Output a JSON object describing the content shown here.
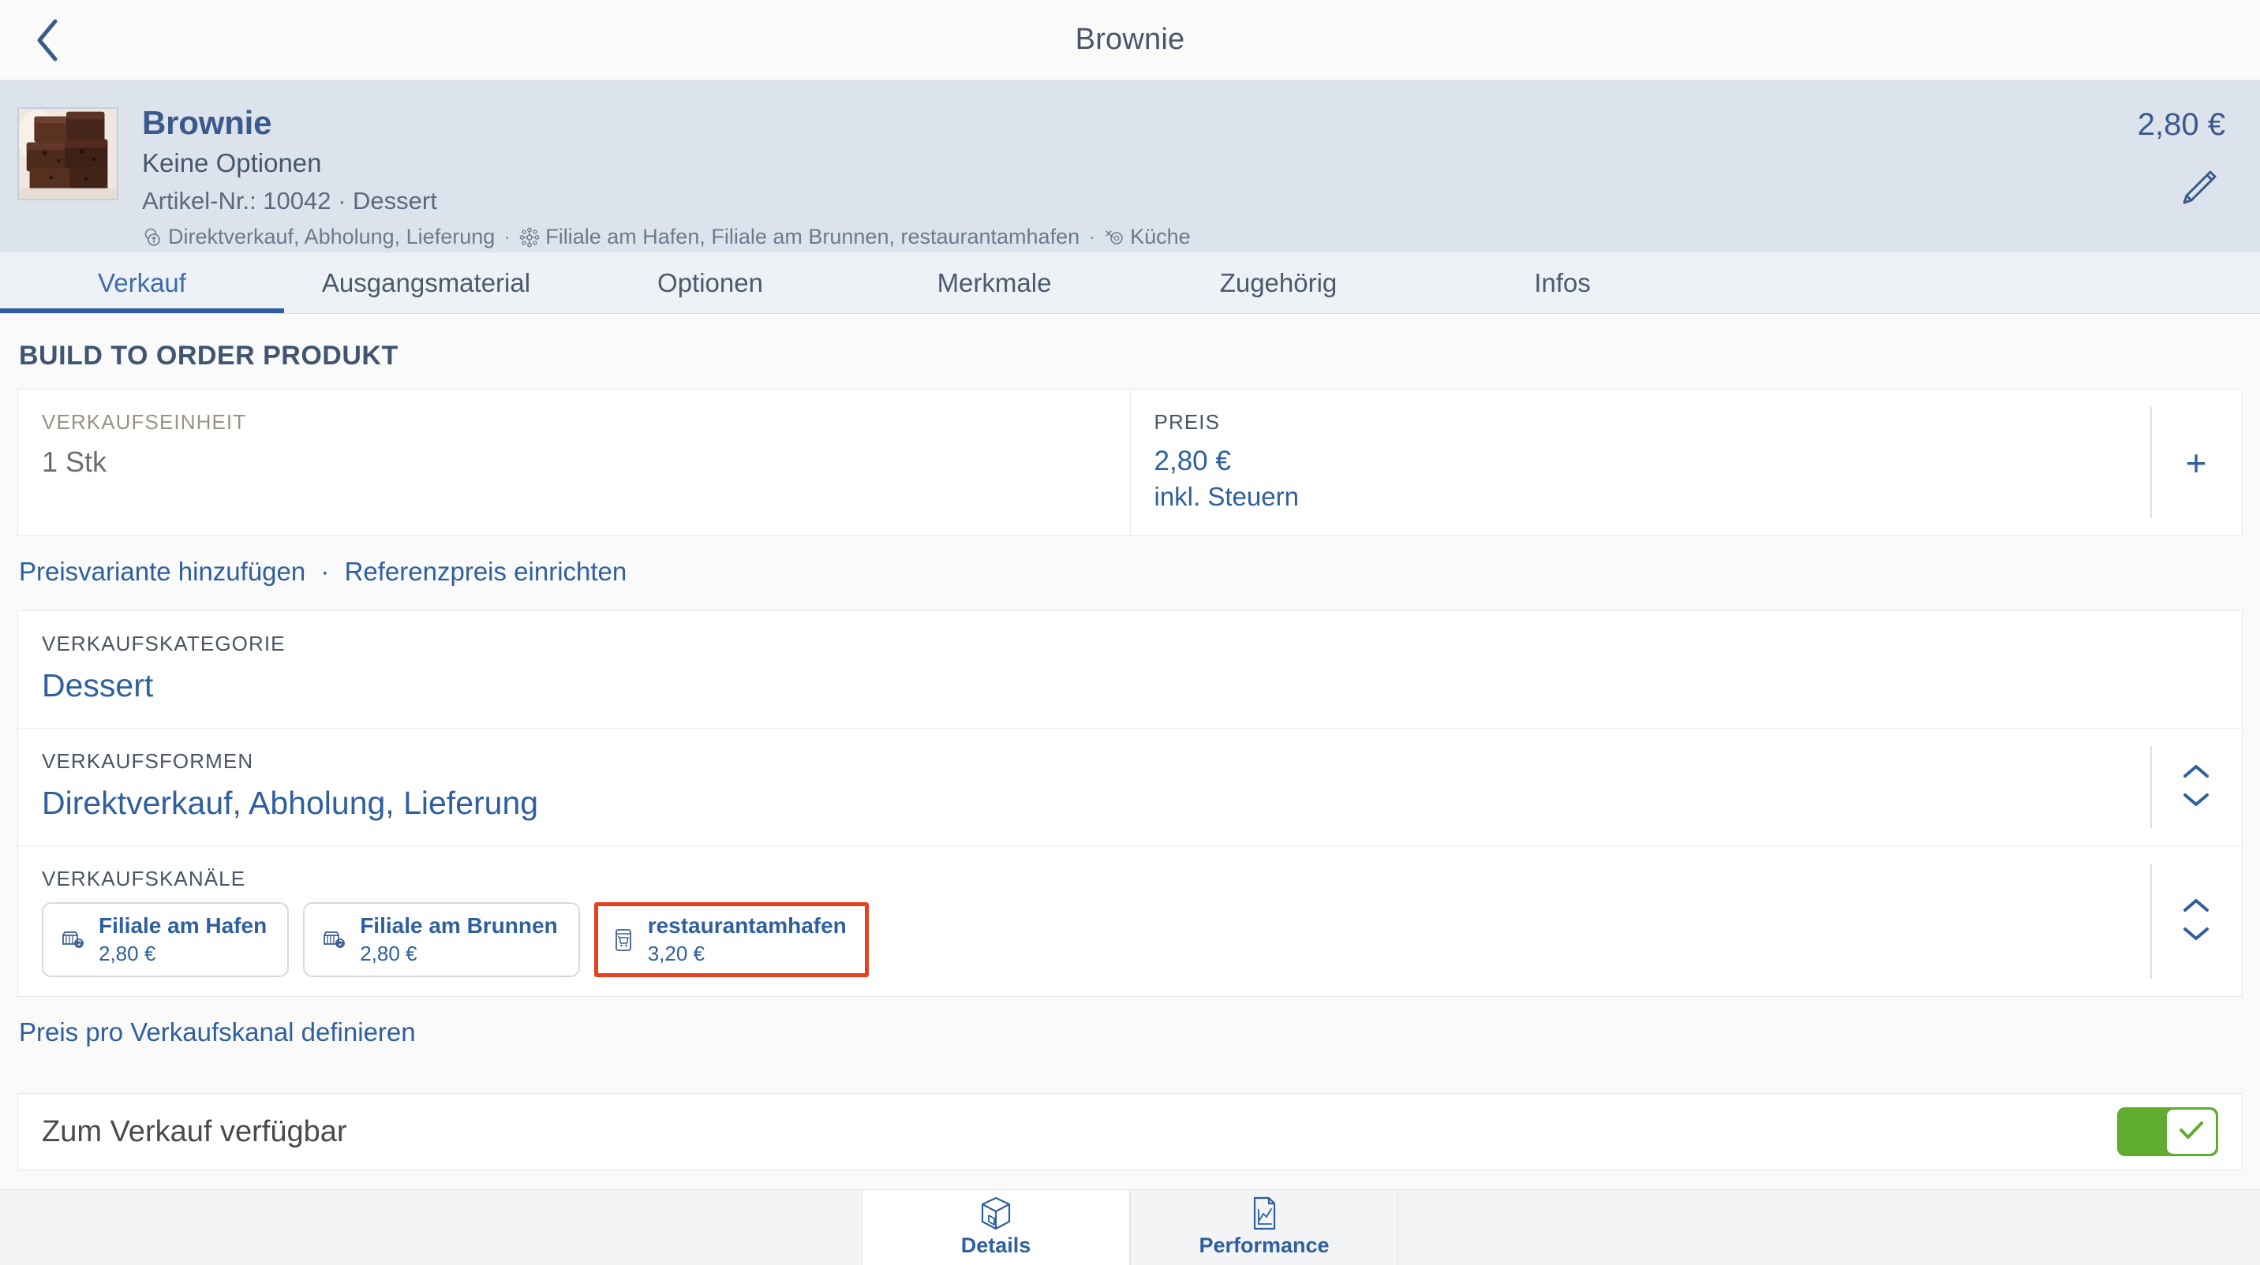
{
  "topbar": {
    "back_icon": "chevron-left-icon",
    "title": "Brownie"
  },
  "product": {
    "name": "Brownie",
    "options": "Keine Optionen",
    "article": "Artikel-Nr.: 10042 · Dessert",
    "tags": {
      "sales_forms_icon": "coins-icon",
      "sales_forms": "Direktverkauf, Abholung, Lieferung",
      "separator": "·",
      "channels_icon": "network-icon",
      "channels": "Filiale am Hafen, Filiale am Brunnen, restaurantamhafen",
      "production_icon": "kitchen-pin-icon",
      "production": "Küche"
    },
    "price": "2,80 €",
    "edit_icon": "pencil-icon"
  },
  "tabs": [
    {
      "label": "Verkauf",
      "active": true
    },
    {
      "label": "Ausgangsmaterial",
      "active": false
    },
    {
      "label": "Optionen",
      "active": false
    },
    {
      "label": "Merkmale",
      "active": false
    },
    {
      "label": "Zugehörig",
      "active": false
    },
    {
      "label": "Infos",
      "active": false
    }
  ],
  "main": {
    "section_title": "BUILD TO ORDER PRODUKT",
    "unit": {
      "label": "VERKAUFSEINHEIT",
      "value": "1 Stk"
    },
    "price": {
      "label": "PREIS",
      "value": "2,80 €",
      "sub": "inkl. Steuern",
      "add_icon": "plus-icon"
    },
    "links": {
      "add_variant": "Preisvariante hinzufügen",
      "separator": "·",
      "reference_price": "Referenzpreis einrichten"
    },
    "category": {
      "label": "VERKAUFSKATEGORIE",
      "value": "Dessert"
    },
    "sales_forms": {
      "label": "VERKAUFSFORMEN",
      "value": "Direktverkauf, Abholung, Lieferung",
      "stepper_up_icon": "chevron-up-icon",
      "stepper_down_icon": "chevron-down-icon"
    },
    "channels": {
      "label": "VERKAUFSKANÄLE",
      "stepper_up_icon": "chevron-up-icon",
      "stepper_down_icon": "chevron-down-icon",
      "items": [
        {
          "name": "Filiale am Hafen",
          "price": "2,80 €",
          "icon": "store-pin-icon",
          "highlighted": false
        },
        {
          "name": "Filiale am Brunnen",
          "price": "2,80 €",
          "icon": "store-pin-icon",
          "highlighted": false
        },
        {
          "name": "restaurantamhafen",
          "price": "3,20 €",
          "icon": "online-shop-icon",
          "highlighted": true
        }
      ]
    },
    "channel_price_link": "Preis pro Verkaufskanal definieren",
    "availability": {
      "label": "Zum Verkauf verfügbar",
      "enabled": true,
      "check_icon": "check-icon"
    }
  },
  "bottombar": [
    {
      "label": "Details",
      "icon": "box-icon",
      "active": true
    },
    {
      "label": "Performance",
      "icon": "chart-document-icon",
      "active": false
    }
  ],
  "colors": {
    "accent_blue": "#2f5f9e",
    "title_blue": "#3a5a8c",
    "header_bg": "#dde3ec",
    "highlight_red": "#e8401f",
    "toggle_green": "#5fac30"
  }
}
